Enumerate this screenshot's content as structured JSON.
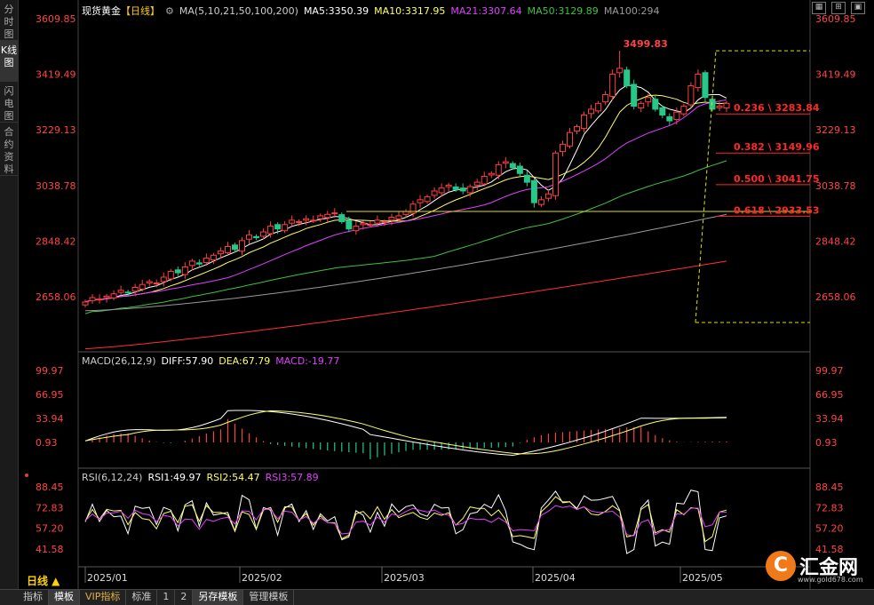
{
  "sidebar": {
    "items": [
      {
        "label": "分时图",
        "active": false
      },
      {
        "label": "K线图",
        "active": true
      },
      {
        "label": "闪电图",
        "active": false
      },
      {
        "label": "合约资料",
        "active": false
      }
    ]
  },
  "header": {
    "title": "现货黄金",
    "period_tag": "【日线】",
    "ma_label": "MA(5,10,21,50,100,200)",
    "ma5": "MA5:3350.39",
    "ma10": "MA10:3317.95",
    "ma21": "MA21:3307.64",
    "ma50": "MA50:3129.89",
    "ma100": "MA100:294"
  },
  "colors": {
    "up": "#ff4040",
    "down": "#26c88a",
    "ma5": "#ffffff",
    "ma10": "#ffff66",
    "ma21": "#e040ff",
    "ma50": "#40c040",
    "ma100": "#999999",
    "ma200": "#ff3030",
    "axis_text": "#ff4444",
    "fib": "#ff2828",
    "hline": "#e0e000"
  },
  "price_axis": {
    "left": [
      "3609.85",
      "3419.49",
      "3229.13",
      "3038.78",
      "2848.42",
      "2658.06"
    ],
    "right": [
      "3609.85",
      "3419.49",
      "3229.13",
      "3038.78",
      "2848.42",
      "2658.06"
    ]
  },
  "annotations": {
    "high_label": "3499.83",
    "fib": [
      {
        "label": "0.236 \\ 3283.84",
        "value": 3283.84
      },
      {
        "label": "0.382 \\ 3149.96",
        "value": 3149.96
      },
      {
        "label": "0.500 \\ 3041.75",
        "value": 3041.75
      },
      {
        "label": "0.618 \\ 2933.53",
        "value": 2933.53
      }
    ]
  },
  "macd": {
    "params": "MACD(26,12,9)",
    "diff": "DIFF:57.90",
    "dea": "DEA:67.79",
    "macd": "MACD:-19.77",
    "axis": [
      "99.97",
      "66.95",
      "33.94",
      "0.93"
    ]
  },
  "rsi": {
    "params": "RSI(6,12,24)",
    "rsi1": "RSI1:49.97",
    "rsi2": "RSI2:54.47",
    "rsi3": "RSI3:57.89",
    "axis": [
      "88.45",
      "72.83",
      "57.20",
      "41.58"
    ]
  },
  "x_axis": [
    "2025/01",
    "2025/02",
    "2025/03",
    "2025/04",
    "2025/05"
  ],
  "period_button": "日线 ▲",
  "bottom_tabs": [
    {
      "label": "指标",
      "active": false,
      "vip": false
    },
    {
      "label": "模板",
      "active": true,
      "vip": false
    },
    {
      "label": "VIP指标",
      "active": false,
      "vip": true
    },
    {
      "label": "标准",
      "active": false,
      "vip": false
    },
    {
      "label": "1",
      "active": false,
      "vip": false
    },
    {
      "label": "2",
      "active": false,
      "vip": false
    },
    {
      "label": "另存模板",
      "active": true,
      "vip": false
    },
    {
      "label": "管理模板",
      "active": false,
      "vip": false
    }
  ],
  "logo": {
    "text": "汇金网",
    "url": "www.gold678.com"
  },
  "chart_data": {
    "type": "candlestick",
    "symbol": "现货黄金",
    "period": "日线",
    "y_range": [
      2560,
      3660
    ],
    "close_path": [
      2640,
      2655,
      2650,
      2660,
      2668,
      2680,
      2672,
      2690,
      2700,
      2710,
      2705,
      2725,
      2745,
      2740,
      2760,
      2780,
      2770,
      2790,
      2800,
      2815,
      2830,
      2820,
      2850,
      2870,
      2860,
      2880,
      2900,
      2890,
      2905,
      2920,
      2915,
      2925,
      2920,
      2935,
      2940,
      2945,
      2915,
      2890,
      2900,
      2910,
      2905,
      2920,
      2915,
      2930,
      2935,
      2950,
      2975,
      2990,
      3000,
      3020,
      3030,
      3040,
      3025,
      3020,
      3035,
      3050,
      3070,
      3080,
      3110,
      3120,
      3100,
      3080,
      3050,
      2980,
      2990,
      3010,
      3150,
      3180,
      3220,
      3240,
      3280,
      3300,
      3320,
      3350,
      3420,
      3440,
      3380,
      3310,
      3320,
      3340,
      3300,
      3280,
      3260,
      3290,
      3310,
      3380,
      3420,
      3340,
      3300,
      3310,
      3320
    ]
  }
}
